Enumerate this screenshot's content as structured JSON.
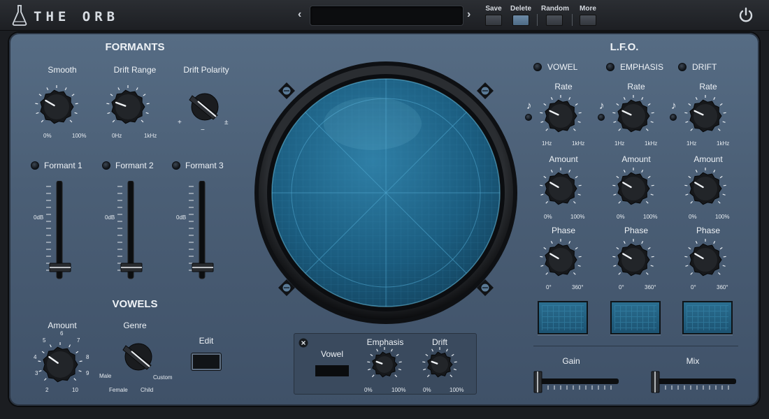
{
  "header": {
    "title": "THE ORB",
    "prev_label": "‹",
    "next_label": "›",
    "preset_name": "",
    "buttons": [
      {
        "label": "Save"
      },
      {
        "label": "Delete"
      },
      {
        "label": "Random"
      },
      {
        "label": "More"
      }
    ]
  },
  "formants": {
    "title": "FORMANTS",
    "knobs": [
      {
        "label": "Smooth",
        "min": "0%",
        "max": "100%"
      },
      {
        "label": "Drift Range",
        "min": "0Hz",
        "max": "1kHz"
      },
      {
        "label": "Drift Polarity",
        "plus": "+",
        "minus": "−",
        "plusminus": "±"
      }
    ],
    "sliders": [
      {
        "label": "Formant 1",
        "mark": "0dB"
      },
      {
        "label": "Formant 2",
        "mark": "0dB"
      },
      {
        "label": "Formant 3",
        "mark": "0dB"
      }
    ]
  },
  "vowels": {
    "title": "VOWELS",
    "amount_label": "Amount",
    "amount_ticks": [
      "6",
      "5",
      "7",
      "4",
      "8",
      "3",
      "9",
      "2",
      "10"
    ],
    "genre_label": "Genre",
    "genre_options": [
      "Male",
      "Female",
      "Child",
      "Custom"
    ],
    "edit_label": "Edit"
  },
  "orb_panel": {
    "vowel_label": "Vowel",
    "emphasis_label": "Emphasis",
    "drift_label": "Drift",
    "min": "0%",
    "max": "100%"
  },
  "lfo": {
    "title": "L.F.O.",
    "columns": [
      {
        "name": "VOWEL"
      },
      {
        "name": "EMPHASIS"
      },
      {
        "name": "DRIFT"
      }
    ],
    "rate_label": "Rate",
    "rate_min": "1Hz",
    "rate_max": "1kHz",
    "amount_label": "Amount",
    "amount_min": "0%",
    "amount_max": "100%",
    "phase_label": "Phase",
    "phase_min": "0°",
    "phase_max": "360°",
    "note_glyph": "♪"
  },
  "output": {
    "gain_label": "Gain",
    "mix_label": "Mix"
  },
  "colors": {
    "panel": "#4f647b",
    "screen": "#1e5876",
    "accent": "#6c8aa6"
  }
}
